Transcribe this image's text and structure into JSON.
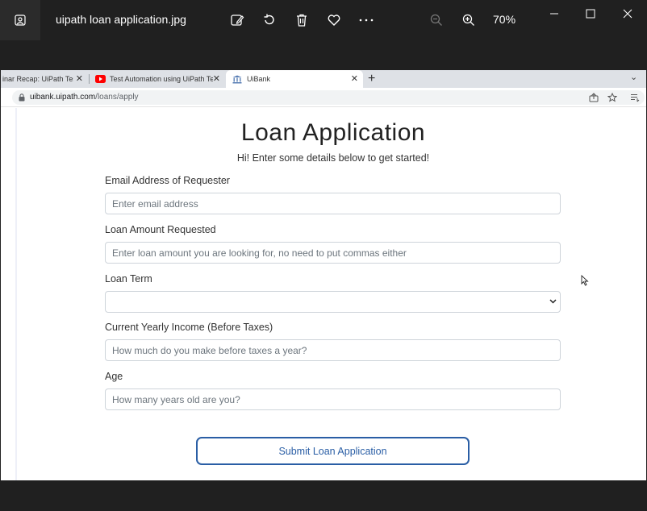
{
  "viewer": {
    "file_name": "uipath loan application.jpg",
    "zoom": "70%",
    "icons": [
      "gallery-icon",
      "edit-image-icon",
      "rotate-icon",
      "delete-icon",
      "favorite-icon",
      "more-icon",
      "zoom-out-icon",
      "zoom-in-icon",
      "minimize-icon",
      "maximize-icon",
      "close-icon"
    ]
  },
  "browser": {
    "tabs": [
      {
        "label": "inar Recap: UiPath Test A"
      },
      {
        "label": "Test Automation using UiPath Te"
      },
      {
        "label": "UiBank"
      }
    ],
    "url_host": "uibank.uipath.com",
    "url_path": "/loans/apply"
  },
  "form": {
    "title": "Loan Application",
    "subtitle": "Hi! Enter some details below to get started!",
    "fields": [
      {
        "label": "Email Address of Requester",
        "placeholder": "Enter email address"
      },
      {
        "label": "Loan Amount Requested",
        "placeholder": "Enter loan amount you are looking for, no need to put commas either"
      },
      {
        "label": "Loan Term",
        "value": ""
      },
      {
        "label": "Current Yearly Income (Before Taxes)",
        "placeholder": "How much do you make before taxes a year?"
      },
      {
        "label": "Age",
        "placeholder": "How many years old are you?"
      }
    ],
    "submit_label": "Submit Loan Application"
  }
}
